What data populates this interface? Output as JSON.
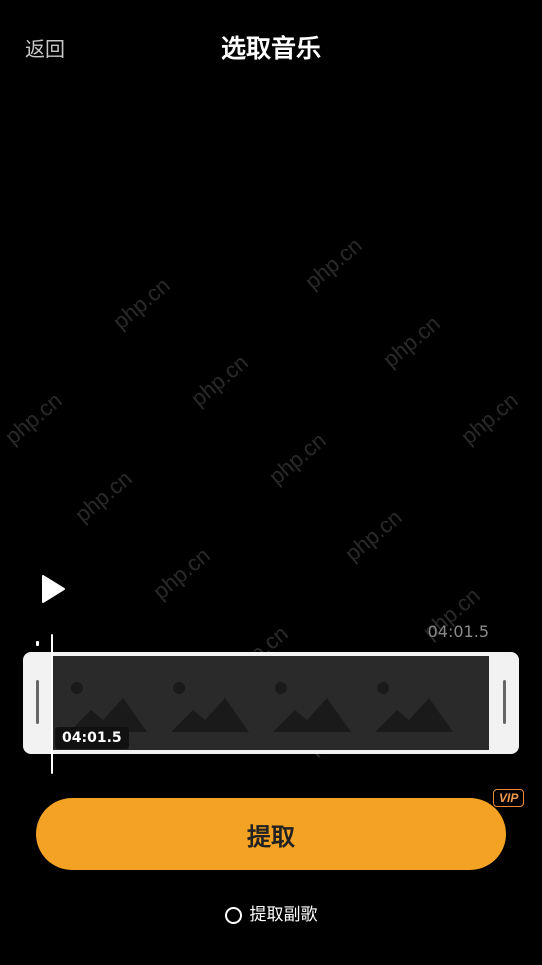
{
  "header": {
    "back_label": "返回",
    "title": "选取音乐"
  },
  "watermark": {
    "text": "php.cn"
  },
  "player": {
    "play_icon": "play-icon",
    "total_duration": "04:01.5",
    "current_time": "04:01.5"
  },
  "actions": {
    "extract_label": "提取",
    "vip_badge": "VIP",
    "chorus_label": "提取副歌"
  },
  "colors": {
    "accent": "#f4a223",
    "vip": "#e88a3a",
    "background": "#000000"
  }
}
